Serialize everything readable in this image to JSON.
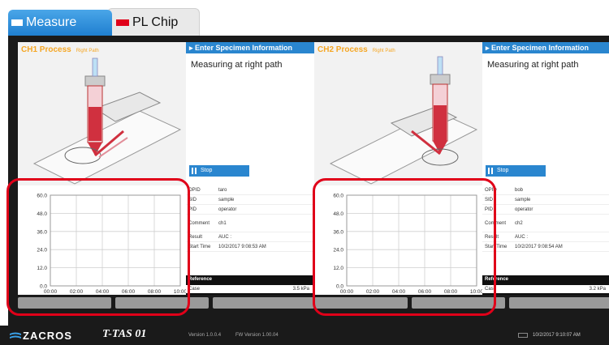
{
  "tabs": [
    {
      "label": "Measure"
    },
    {
      "label": "PL Chip"
    }
  ],
  "channels": [
    {
      "title": "CH1 Process",
      "path": "Right Path",
      "specimen_header": "Enter Specimen Information",
      "status": "Measuring at right path",
      "stop_label": "Stop",
      "info": {
        "opid_label": "OPID",
        "opid": "taro",
        "sid_label": "SID",
        "sid": "sample",
        "pid_label": "PID",
        "pid": "operator",
        "comment_label": "Comment",
        "comment": "ch1",
        "result_label": "Result",
        "result": "AUC :",
        "start_label": "Start Time",
        "start": "10/2/2017 9:08:53 AM"
      },
      "reference_label": "Reference",
      "case_label": "Case",
      "case_value": "3.5 kPa"
    },
    {
      "title": "CH2 Process",
      "path": "Right Path",
      "specimen_header": "Enter Specimen Information",
      "status": "Measuring at right path",
      "stop_label": "Stop",
      "info": {
        "opid_label": "OPID",
        "opid": "bob",
        "sid_label": "SID",
        "sid": "sample",
        "pid_label": "PID",
        "pid": "operator",
        "comment_label": "Comment",
        "comment": "ch2",
        "result_label": "Result",
        "result": "AUC :",
        "start_label": "Start Time",
        "start": "10/2/2017 9:08:54 AM"
      },
      "reference_label": "Reference",
      "case_label": "Case",
      "case_value": "3.2 kPa"
    }
  ],
  "chart_data": [
    {
      "type": "line",
      "title": "",
      "yticks": [
        "60.0",
        "48.0",
        "36.0",
        "24.0",
        "12.0",
        "0.0"
      ],
      "xticks": [
        "00:00",
        "02:00",
        "04:00",
        "06:00",
        "08:00",
        "10:00"
      ],
      "ylim": [
        0,
        60
      ],
      "xlim": [
        "00:00",
        "10:00"
      ],
      "grid": true,
      "series": []
    },
    {
      "type": "line",
      "title": "",
      "yticks": [
        "60.0",
        "48.0",
        "36.0",
        "24.0",
        "12.0",
        "0.0"
      ],
      "xticks": [
        "00:00",
        "02:00",
        "04:00",
        "06:00",
        "08:00",
        "10:00"
      ],
      "ylim": [
        0,
        60
      ],
      "xlim": [
        "00:00",
        "10:00"
      ],
      "grid": true,
      "series": []
    }
  ],
  "footer": {
    "brand": "ZACROS",
    "product": "T-TAS 01",
    "version": "Version 1.0.0.4",
    "fw_version": "FW Version 1.00.04",
    "datetime": "10/2/2017 9:10:07 AM"
  },
  "colors": {
    "accent": "#2a86cf",
    "process_title": "#f5a623",
    "highlight": "#e00019"
  }
}
